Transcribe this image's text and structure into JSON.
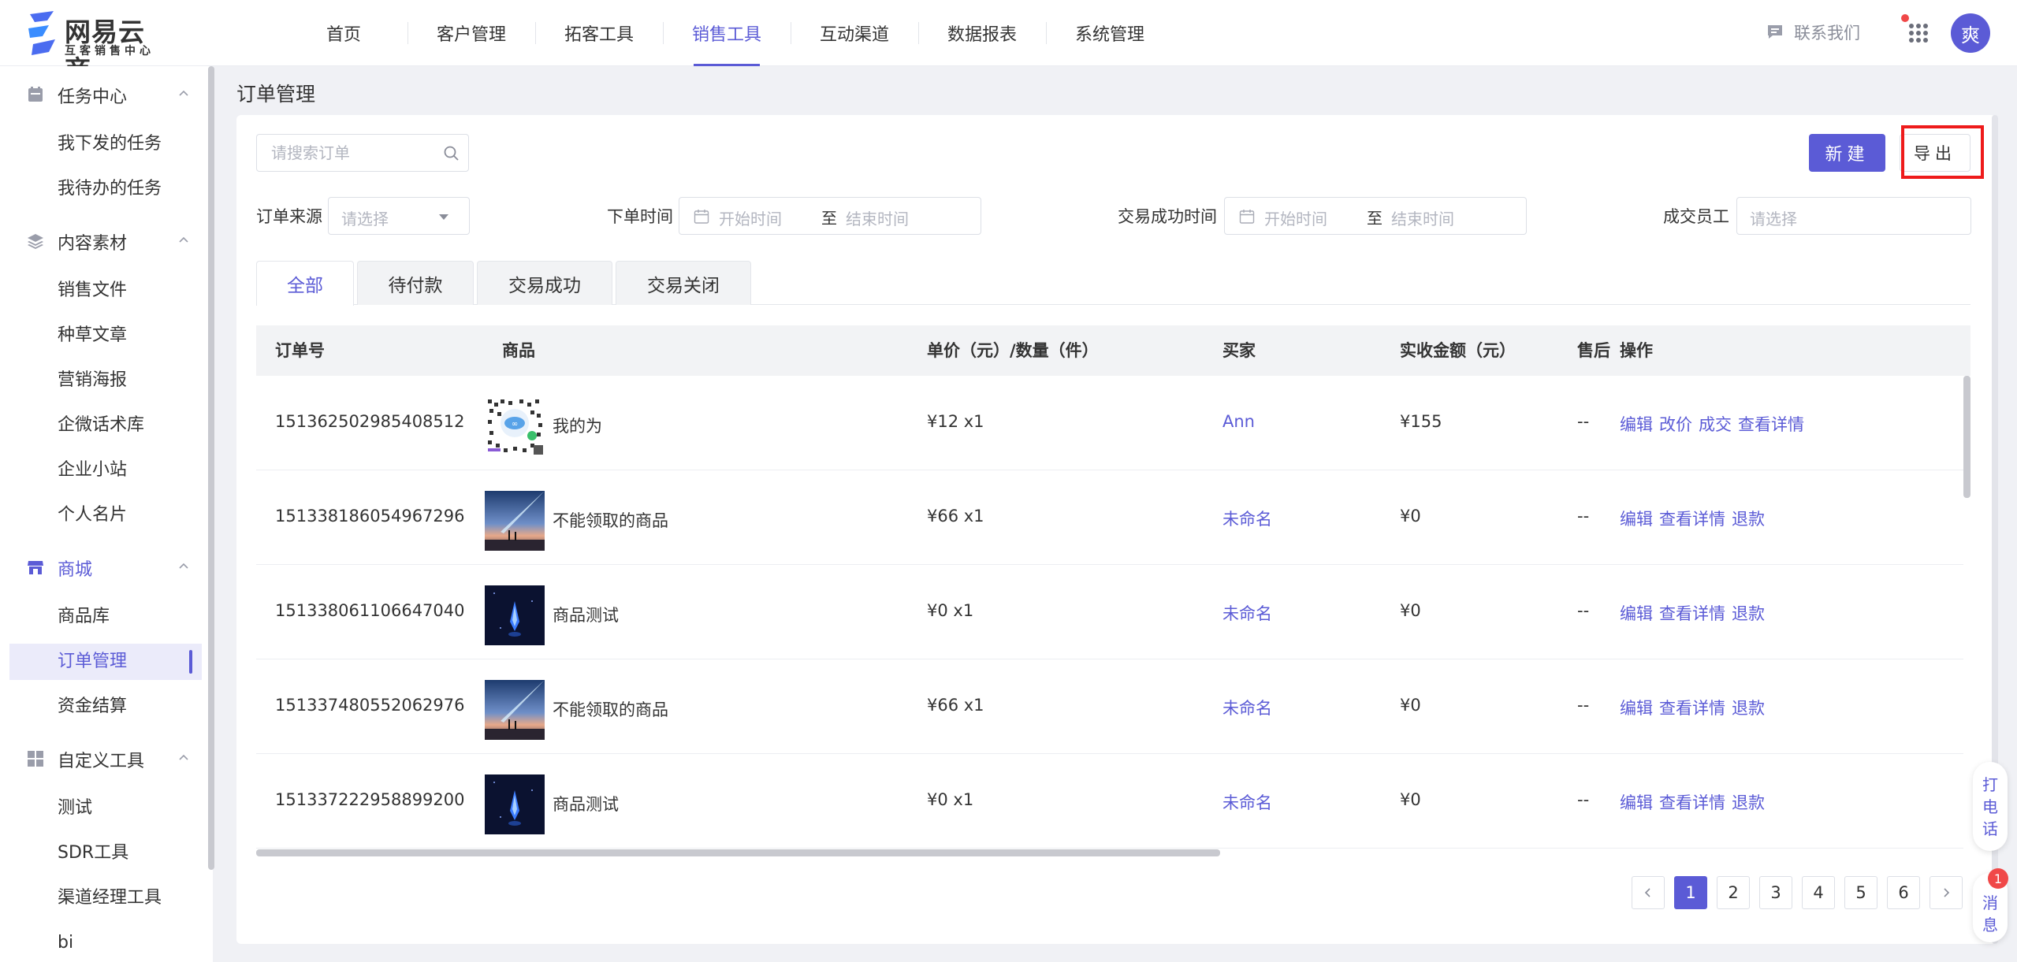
{
  "brand": {
    "name": "网易云商",
    "tagline": "互客销售中心"
  },
  "nav": {
    "items": [
      {
        "label": "首页"
      },
      {
        "label": "客户管理"
      },
      {
        "label": "拓客工具"
      },
      {
        "label": "销售工具",
        "active": true
      },
      {
        "label": "互动渠道"
      },
      {
        "label": "数据报表"
      },
      {
        "label": "系统管理"
      }
    ],
    "contact_label": "联系我们",
    "avatar_text": "爽",
    "apps_icon": "grid-apps-icon",
    "contact_icon": "chat-bubble-icon"
  },
  "sidebar": {
    "groups": [
      {
        "label": "任务中心",
        "icon": "task-icon",
        "items": [
          {
            "label": "我下发的任务"
          },
          {
            "label": "我待办的任务"
          }
        ]
      },
      {
        "label": "内容素材",
        "icon": "layers-icon",
        "items": [
          {
            "label": "销售文件"
          },
          {
            "label": "种草文章"
          },
          {
            "label": "营销海报"
          },
          {
            "label": "企微话术库"
          },
          {
            "label": "企业小站"
          },
          {
            "label": "个人名片"
          }
        ]
      },
      {
        "label": "商城",
        "icon": "store-icon",
        "active": true,
        "items": [
          {
            "label": "商品库"
          },
          {
            "label": "订单管理",
            "active": true
          },
          {
            "label": "资金结算"
          }
        ]
      },
      {
        "label": "自定义工具",
        "icon": "grid-icon",
        "items": [
          {
            "label": "测试"
          },
          {
            "label": "SDR工具"
          },
          {
            "label": "渠道经理工具"
          },
          {
            "label": "bi"
          }
        ]
      }
    ]
  },
  "page": {
    "title": "订单管理"
  },
  "toolbar": {
    "search_placeholder": "请搜索订单",
    "new_label": "新建",
    "export_label": "导出"
  },
  "filters": {
    "source_label": "订单来源",
    "source_placeholder": "请选择",
    "order_time_label": "下单时间",
    "success_time_label": "交易成功时间",
    "start_placeholder": "开始时间",
    "end_placeholder": "结束时间",
    "range_sep": "至",
    "staff_label": "成交员工",
    "staff_placeholder": "请选择"
  },
  "tabs": [
    {
      "label": "全部",
      "active": true
    },
    {
      "label": "待付款"
    },
    {
      "label": "交易成功"
    },
    {
      "label": "交易关闭"
    }
  ],
  "table": {
    "columns": [
      "订单号",
      "商品",
      "单价（元）/数量（件）",
      "买家",
      "实收金额（元）",
      "售后",
      "操作"
    ],
    "rows": [
      {
        "order_no": "151362502985408512",
        "product": "我的为",
        "thumb": "qr",
        "price_qty": "¥12 x1",
        "buyer": "Ann",
        "amount": "¥155",
        "after_sale": "--",
        "ops": [
          "编辑",
          "改价",
          "成交",
          "查看详情"
        ]
      },
      {
        "order_no": "151338186054967296",
        "product": "不能领取的商品",
        "thumb": "sky",
        "price_qty": "¥66 x1",
        "buyer": "未命名",
        "amount": "¥0",
        "after_sale": "--",
        "ops": [
          "编辑",
          "查看详情",
          "退款"
        ]
      },
      {
        "order_no": "151338061106647040",
        "product": "商品测试",
        "thumb": "rocket",
        "price_qty": "¥0 x1",
        "buyer": "未命名",
        "amount": "¥0",
        "after_sale": "--",
        "ops": [
          "编辑",
          "查看详情",
          "退款"
        ]
      },
      {
        "order_no": "151337480552062976",
        "product": "不能领取的商品",
        "thumb": "sky",
        "price_qty": "¥66 x1",
        "buyer": "未命名",
        "amount": "¥0",
        "after_sale": "--",
        "ops": [
          "编辑",
          "查看详情",
          "退款"
        ]
      },
      {
        "order_no": "151337222958899200",
        "product": "商品测试",
        "thumb": "rocket",
        "price_qty": "¥0 x1",
        "buyer": "未命名",
        "amount": "¥0",
        "after_sale": "--",
        "ops": [
          "编辑",
          "查看详情",
          "退款"
        ]
      }
    ]
  },
  "pagination": {
    "pages": [
      "1",
      "2",
      "3",
      "4",
      "5",
      "6"
    ],
    "current": "1"
  },
  "floating": {
    "call_label": [
      "打",
      "电",
      "话"
    ],
    "message_label": [
      "消",
      "息"
    ],
    "message_badge": "1"
  },
  "colors": {
    "accent": "#5b5bd6",
    "highlight": "#ee1b1b",
    "badge": "#f04848"
  }
}
